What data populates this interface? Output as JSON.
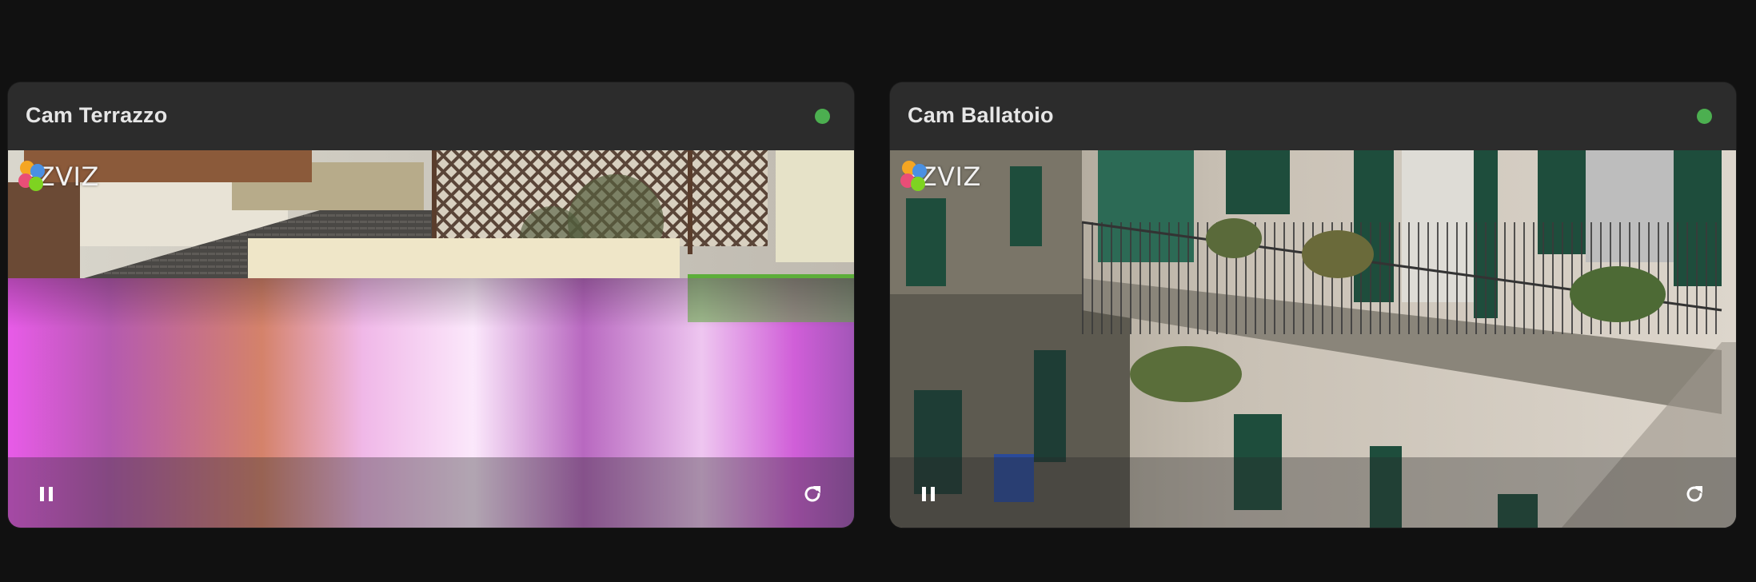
{
  "cameras": [
    {
      "title": "Cam Terrazzo",
      "status_color": "#4caf50",
      "brand": "EZVIZ",
      "icons": {
        "status": "status-dot",
        "brand": "ezviz-logo-icon",
        "pause": "pause-icon",
        "refresh": "refresh-icon"
      }
    },
    {
      "title": "Cam Ballatoio",
      "status_color": "#4caf50",
      "brand": "EZVIZ",
      "icons": {
        "status": "status-dot",
        "brand": "ezviz-logo-icon",
        "pause": "pause-icon",
        "refresh": "refresh-icon"
      }
    }
  ]
}
